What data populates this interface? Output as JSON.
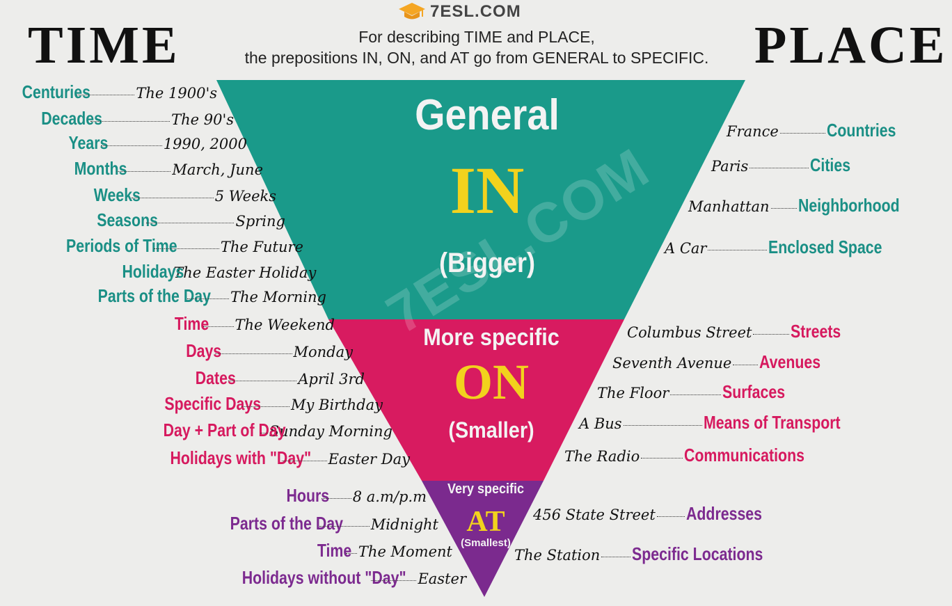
{
  "header": {
    "left_title": "TIME",
    "right_title": "PLACE",
    "logo": "7ESL.COM",
    "subtitle_line1": "For describing TIME and PLACE,",
    "subtitle_line2": "the prepositions IN, ON, and AT go from GENERAL to SPECIFIC."
  },
  "triangle": {
    "in": {
      "top_label": "General",
      "preposition": "IN",
      "size_label": "(Bigger)",
      "color": "#1a9a8a"
    },
    "on": {
      "top_label": "More specific",
      "preposition": "ON",
      "size_label": "(Smaller)",
      "color": "#d81b60"
    },
    "at": {
      "top_label": "Very specific",
      "preposition": "AT",
      "size_label": "(Smallest)",
      "color": "#7b2a8e"
    },
    "watermark": "7ESL.COM"
  },
  "time": {
    "in": [
      {
        "category": "Centuries",
        "example": "The 1900's"
      },
      {
        "category": "Decades",
        "example": "The 90's"
      },
      {
        "category": "Years",
        "example": "1990, 2000"
      },
      {
        "category": "Months",
        "example": "March, June"
      },
      {
        "category": "Weeks",
        "example": "5 Weeks"
      },
      {
        "category": "Seasons",
        "example": "Spring"
      },
      {
        "category": "Periods of Time",
        "example": "The Future"
      },
      {
        "category": "Holidays",
        "example": "The Easter Holiday"
      },
      {
        "category": "Parts of the Day",
        "example": "The Morning"
      }
    ],
    "on": [
      {
        "category": "Time",
        "example": "The Weekend"
      },
      {
        "category": "Days",
        "example": "Monday"
      },
      {
        "category": "Dates",
        "example": "April 3rd"
      },
      {
        "category": "Specific Days",
        "example": "My Birthday"
      },
      {
        "category": "Day + Part of Day",
        "example": "Sunday Morning"
      },
      {
        "category": "Holidays with \"Day\"",
        "example": "Easter Day"
      }
    ],
    "at": [
      {
        "category": "Hours",
        "example": "8 a.m/p.m"
      },
      {
        "category": "Parts of the Day",
        "example": "Midnight"
      },
      {
        "category": "Time",
        "example": "The Moment"
      },
      {
        "category": "Holidays without \"Day\"",
        "example": "Easter"
      }
    ]
  },
  "place": {
    "in": [
      {
        "example": "France",
        "category": "Countries"
      },
      {
        "example": "Paris",
        "category": "Cities"
      },
      {
        "example": "Manhattan",
        "category": "Neighborhood"
      },
      {
        "example": "A Car",
        "category": "Enclosed Space"
      }
    ],
    "on": [
      {
        "example": "Columbus Street",
        "category": "Streets"
      },
      {
        "example": "Seventh Avenue",
        "category": "Avenues"
      },
      {
        "example": "The Floor",
        "category": "Surfaces"
      },
      {
        "example": "A Bus",
        "category": "Means of Transport"
      },
      {
        "example": "The Radio",
        "category": "Communications"
      }
    ],
    "at": [
      {
        "example": "456 State Street",
        "category": "Addresses"
      },
      {
        "example": "The Station",
        "category": "Specific Locations"
      }
    ]
  }
}
